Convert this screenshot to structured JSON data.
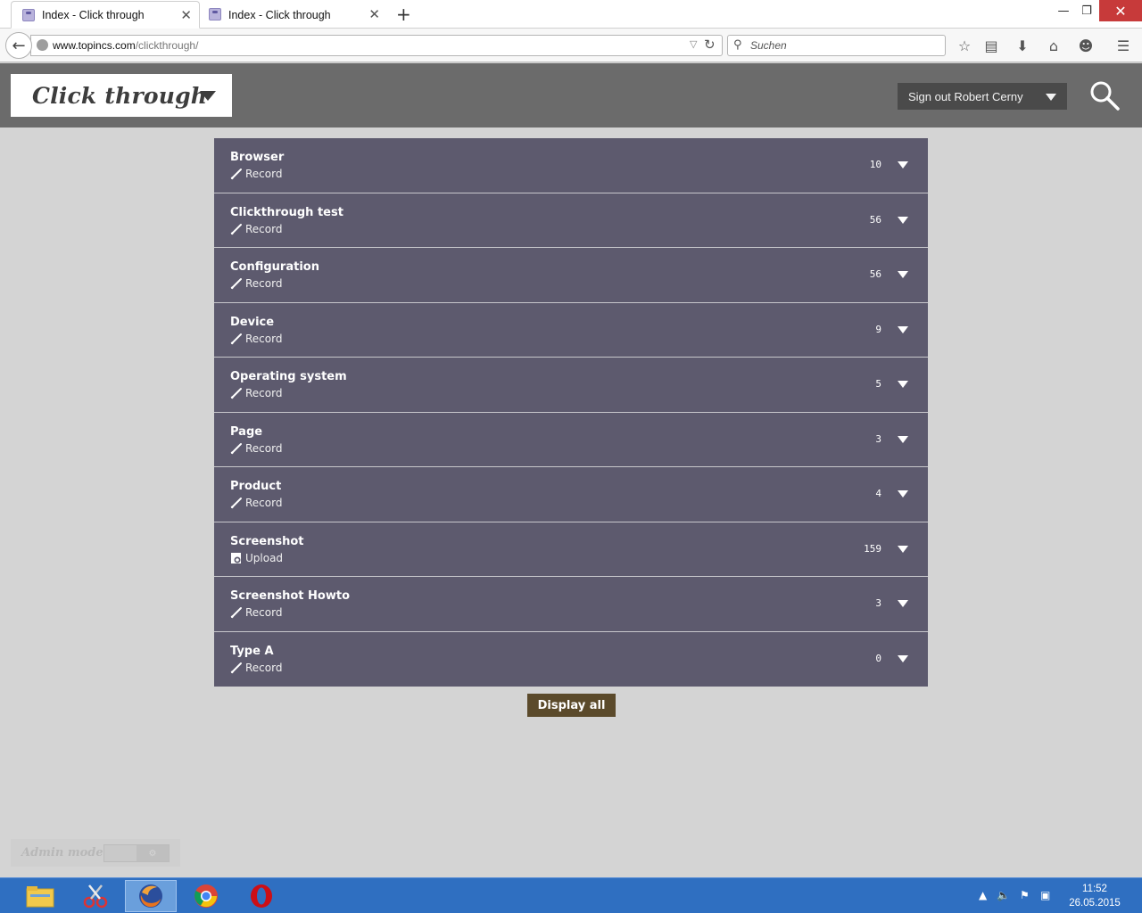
{
  "browser": {
    "tabs": [
      {
        "label": "Index - Click through",
        "active": true
      },
      {
        "label": "Index - Click through",
        "active": false
      }
    ],
    "url_host": "www.topincs.com",
    "url_path": "/clickthrough/",
    "search_placeholder": "Suchen"
  },
  "app": {
    "title": "Click through",
    "signout_label": "Sign out Robert Cerny"
  },
  "rows": [
    {
      "title": "Browser",
      "action": "Record",
      "action_icon": "pencil-icon",
      "count": "10"
    },
    {
      "title": "Clickthrough test",
      "action": "Record",
      "action_icon": "pencil-icon",
      "count": "56"
    },
    {
      "title": "Configuration",
      "action": "Record",
      "action_icon": "pencil-icon",
      "count": "56"
    },
    {
      "title": "Device",
      "action": "Record",
      "action_icon": "pencil-icon",
      "count": "9"
    },
    {
      "title": "Operating system",
      "action": "Record",
      "action_icon": "pencil-icon",
      "count": "5"
    },
    {
      "title": "Page",
      "action": "Record",
      "action_icon": "pencil-icon",
      "count": "3"
    },
    {
      "title": "Product",
      "action": "Record",
      "action_icon": "pencil-icon",
      "count": "4"
    },
    {
      "title": "Screenshot",
      "action": "Upload",
      "action_icon": "upload-icon",
      "count": "159"
    },
    {
      "title": "Screenshot Howto",
      "action": "Record",
      "action_icon": "pencil-icon",
      "count": "3"
    },
    {
      "title": "Type A",
      "action": "Record",
      "action_icon": "pencil-icon",
      "count": "0"
    }
  ],
  "display_all_label": "Display all",
  "admin": {
    "label": "Admin mode"
  },
  "taskbar": {
    "time": "11:52",
    "date": "26.05.2015"
  },
  "colors": {
    "row_bg": "#5d5a6e",
    "header_bg": "#6b6b6b",
    "display_all_bg": "#5b4a2b",
    "taskbar_bg": "#2f6fc1"
  }
}
